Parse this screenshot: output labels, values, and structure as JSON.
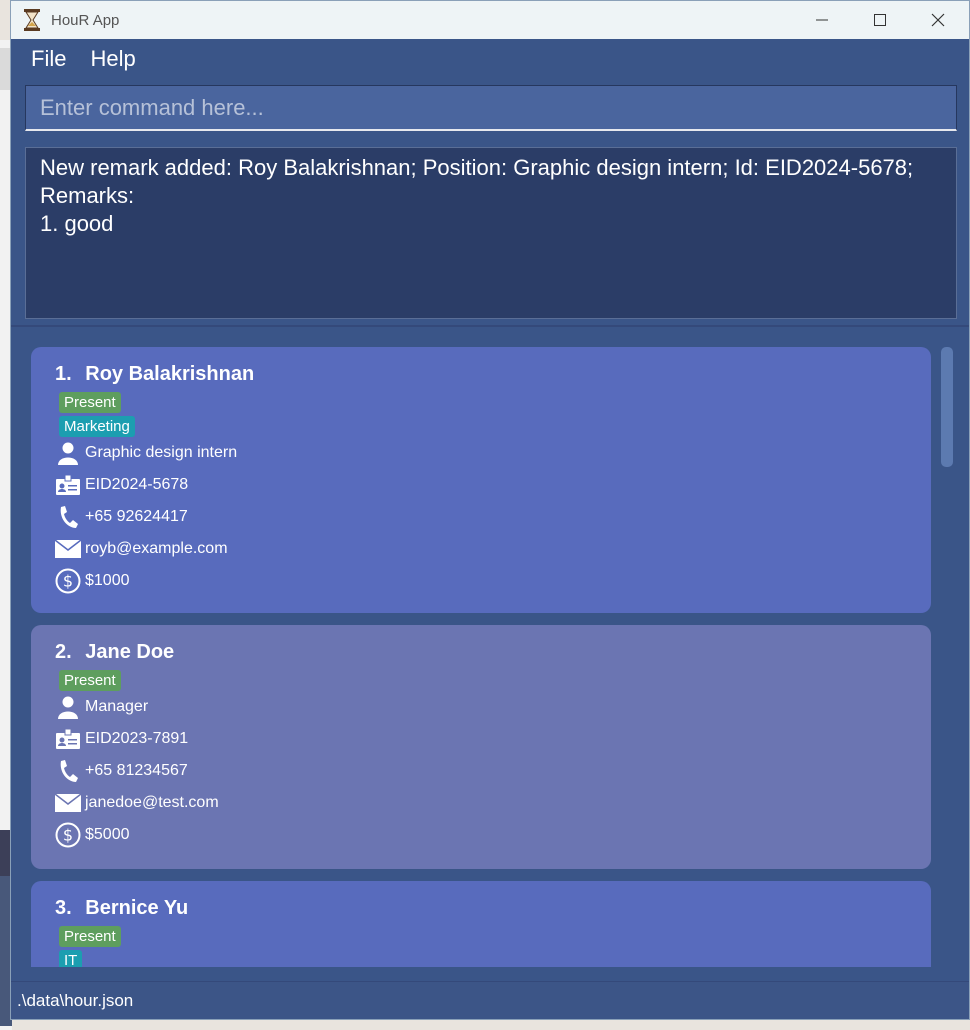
{
  "window": {
    "title": "HouR App"
  },
  "menu": {
    "items": [
      "File",
      "Help"
    ]
  },
  "command": {
    "placeholder": "Enter command here...",
    "value": ""
  },
  "result": {
    "lines": [
      "New remark added: Roy Balakrishnan; Position: Graphic design intern; Id: EID2024-5678;",
      "Remarks:",
      "1. good"
    ]
  },
  "employees": [
    {
      "index": "1.",
      "name": "Roy Balakrishnan",
      "tags": [
        "Present",
        "Marketing"
      ],
      "position": "Graphic design intern",
      "id": "EID2024-5678",
      "phone": "+65 92624417",
      "email": "royb@example.com",
      "salary": "$1000"
    },
    {
      "index": "2.",
      "name": "Jane Doe",
      "tags": [
        "Present"
      ],
      "position": "Manager",
      "id": "EID2023-7891",
      "phone": "+65 81234567",
      "email": "janedoe@test.com",
      "salary": "$5000"
    },
    {
      "index": "3.",
      "name": "Bernice Yu",
      "tags": [
        "Present",
        "IT"
      ]
    }
  ],
  "status": {
    "path": ".\\data\\hour.json"
  },
  "colors": {
    "window_bg": "#3a5588",
    "card_selected": "#586bbd",
    "card_normal": "#6b75b2",
    "tag_status": "#5e9e5e",
    "tag_dept": "#1c9eb0",
    "result_bg": "#2b3d67"
  }
}
